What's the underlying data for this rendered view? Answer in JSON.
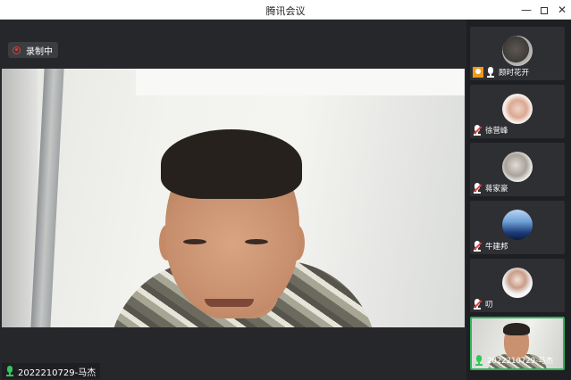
{
  "window": {
    "title": "腾讯会议",
    "controls": {
      "minimize": "—",
      "maximize": "",
      "close": "✕"
    }
  },
  "recording": {
    "label": "录制中"
  },
  "main_speaker": {
    "name": "2022210729-马杰",
    "mic_state": "active"
  },
  "participants": [
    {
      "name": "顾时花开",
      "avatar": "cat-photo",
      "mic_state": "on",
      "badge": "host-orange"
    },
    {
      "name": "徐营峰",
      "avatar": "girl-photo",
      "mic_state": "muted"
    },
    {
      "name": "蒋家豪",
      "avatar": "sleeping-photo",
      "mic_state": "muted"
    },
    {
      "name": "牛建邦",
      "avatar": "city-photo",
      "mic_state": "muted"
    },
    {
      "name": "叨",
      "avatar": "boy-photo",
      "mic_state": "muted"
    },
    {
      "name": "2022210729-马杰",
      "avatar": "video",
      "mic_state": "active",
      "active": true
    }
  ],
  "colors": {
    "accent_green": "#32c85a",
    "recording_red": "#e03b3b",
    "mute_red": "#e04545",
    "host_badge": "#f09a1a"
  }
}
